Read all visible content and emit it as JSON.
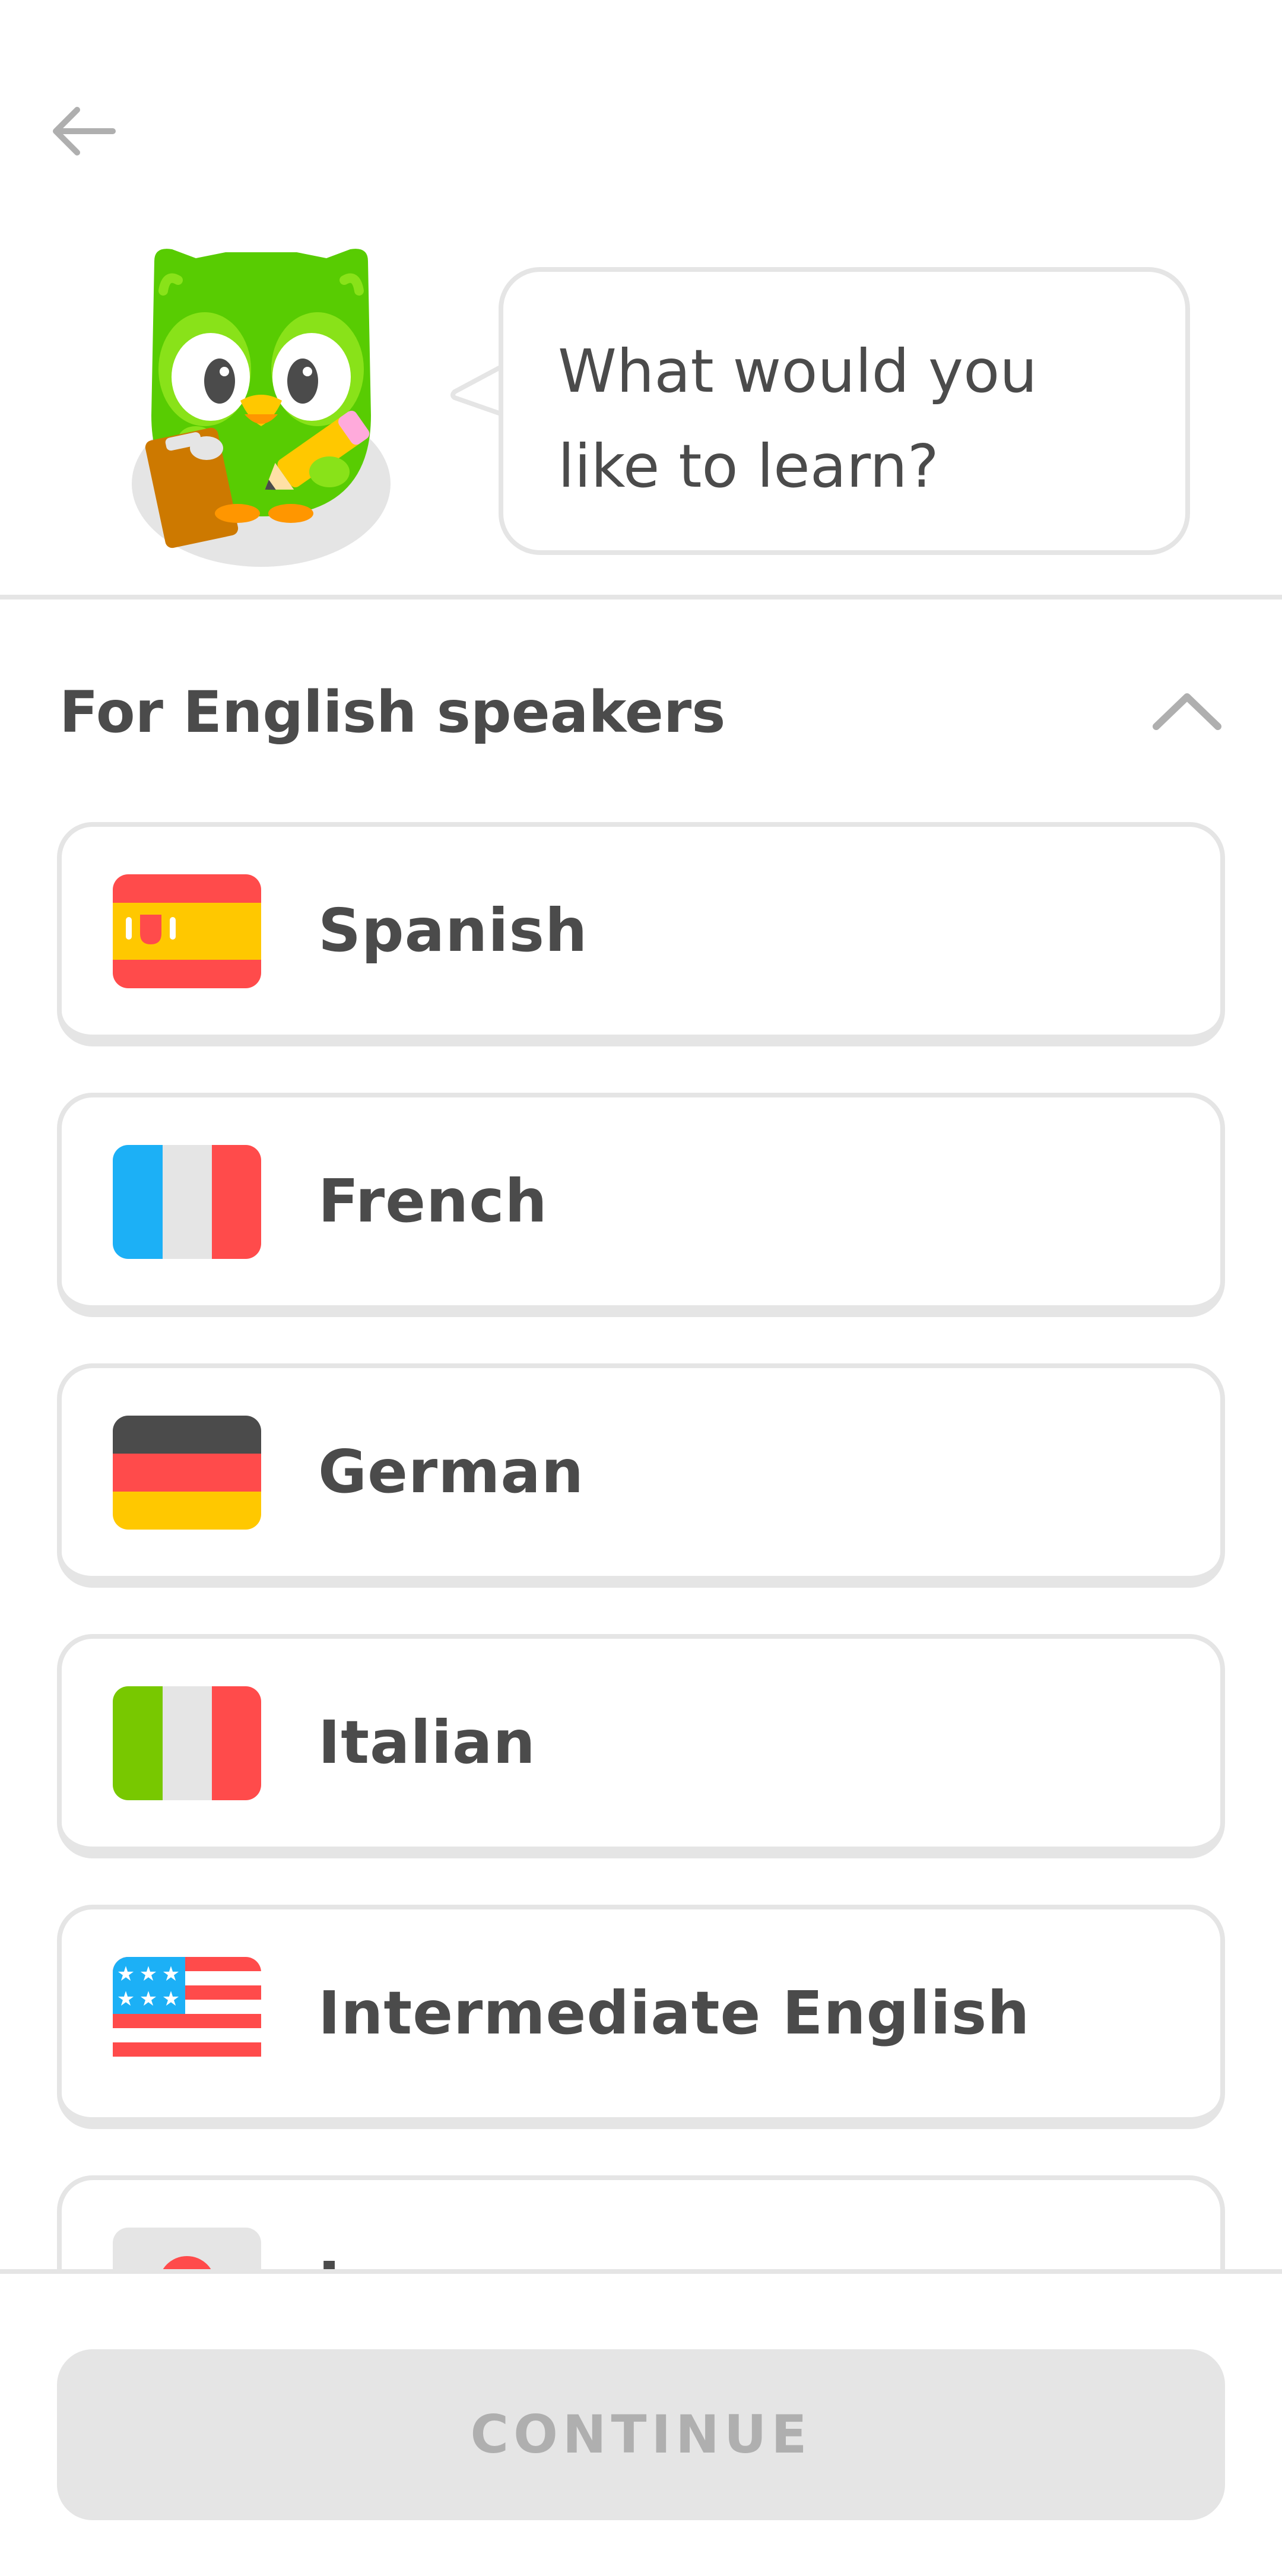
{
  "header": {
    "back_icon": "arrow-left-icon",
    "prompt": "What would you like to learn?"
  },
  "section": {
    "title": "For English speakers",
    "collapse_icon": "chevron-up-icon"
  },
  "languages": [
    {
      "name": "Spanish",
      "flag_icon": "spain-flag-icon"
    },
    {
      "name": "French",
      "flag_icon": "france-flag-icon"
    },
    {
      "name": "German",
      "flag_icon": "germany-flag-icon"
    },
    {
      "name": "Italian",
      "flag_icon": "italy-flag-icon"
    },
    {
      "name": "Intermediate English",
      "flag_icon": "usa-flag-icon"
    },
    {
      "name": "J",
      "flag_icon": "japan-flag-icon"
    }
  ],
  "footer": {
    "continue_label": "CONTINUE"
  },
  "colors": {
    "border": "#e5e5e5",
    "text": "#4b4b4b",
    "disabled_text": "#afafaf",
    "owl_green": "#58cc02"
  }
}
